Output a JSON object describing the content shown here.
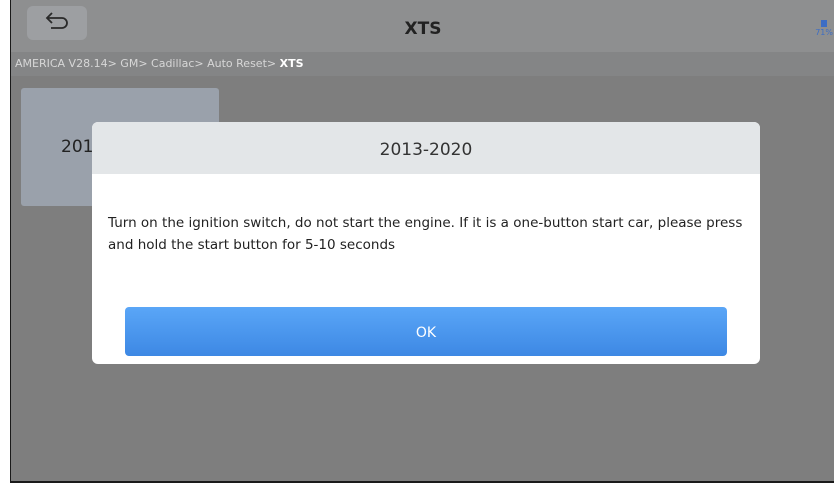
{
  "header": {
    "title": "XTS",
    "back_icon": "back-arrow-icon",
    "battery_text": "71%"
  },
  "breadcrumb": {
    "items": [
      "AMERICA V28.14",
      "GM",
      "Cadillac",
      "Auto Reset"
    ],
    "current": "XTS",
    "separator": ">"
  },
  "tile": {
    "label": "2013-2020"
  },
  "dialog": {
    "title": "2013-2020",
    "message": "Turn on the ignition switch, do not start the engine. If it is a one-button start car, please press and hold the start button for 5-10 seconds",
    "ok_label": "OK"
  },
  "colors": {
    "accent": "#3d88e4",
    "overlay": "#7e7e7e"
  }
}
